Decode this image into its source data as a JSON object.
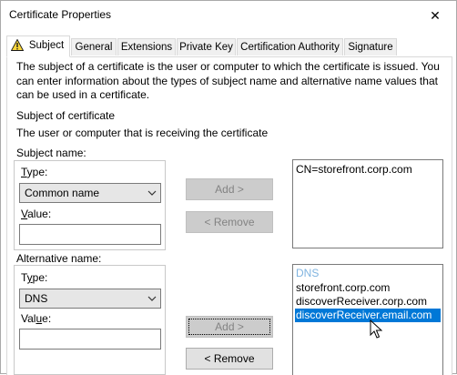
{
  "window": {
    "title": "Certificate Properties",
    "close_glyph": "✕"
  },
  "tabs": [
    {
      "label": "Subject",
      "active": true
    },
    {
      "label": "General"
    },
    {
      "label": "Extensions"
    },
    {
      "label": "Private Key"
    },
    {
      "label": "Certification Authority"
    },
    {
      "label": "Signature"
    }
  ],
  "intro_text": "The subject of a certificate is the user or computer to which the certificate is issued. You can enter information about the types of subject name and alternative name values that can be used in a certificate.",
  "subject_of_certificate": {
    "heading": "Subject of certificate",
    "description": "The user or computer that is receiving the certificate"
  },
  "subject_name": {
    "group_label": "Subject name:",
    "type_label": "Type:",
    "type_value": "Common name",
    "value_label": "Value:",
    "value_text": "",
    "add_button": "Add >",
    "remove_button": "< Remove",
    "list": [
      "CN=storefront.corp.com"
    ]
  },
  "alternative_name": {
    "group_label": "Alternative name:",
    "type_label": "Type:",
    "type_value": "DNS",
    "value_label": "Value:",
    "value_text": "",
    "add_button": "Add >",
    "remove_button": "< Remove",
    "list_header": "DNS",
    "list": [
      "storefront.corp.com",
      "discoverReceiver.corp.com",
      "discoverReceiver.email.com"
    ],
    "selected_item": "discoverReceiver.email.com"
  },
  "colors": {
    "selection": "#0078d7",
    "list_header": "#7fb4e0",
    "disabled_button": "#cccccc"
  },
  "icons": {
    "tab_icon": "warning-icon",
    "dropdown": "chevron-down-icon",
    "pointer": "mouse-cursor-icon"
  }
}
